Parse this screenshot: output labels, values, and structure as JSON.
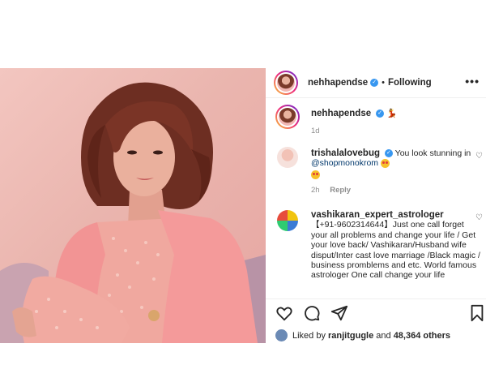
{
  "post": {
    "username": "nehhapendse",
    "separator": "•",
    "follow_status": "Following",
    "more": "•••"
  },
  "caption": {
    "username": "nehhapendse",
    "emoji": "💃",
    "time": "1d"
  },
  "comments": [
    {
      "username": "trishalalovebug",
      "text_before": "You look stunning in ",
      "mention": "@shopmonokrom",
      "time": "2h",
      "reply": "Reply"
    },
    {
      "username": "vashikaran_expert_astrologer",
      "text": "【+91-9602314644】Just one call forget your all problems and change your life / Get your love back/ Vashikaran/Husband wife disput/Inter cast love marriage /Black magic / business promblems and etc. World famous astrologer One call change your life"
    }
  ],
  "likes": {
    "prefix": "Liked by ",
    "user": "ranjitgugle",
    "middle": " and ",
    "count": "48,364 others"
  },
  "icons": [
    "heart-icon",
    "comment-icon",
    "share-icon",
    "bookmark-icon",
    "verified-icon",
    "more-options-icon"
  ],
  "colors": {
    "verified": "#3897f0",
    "muted": "#8e8e8e",
    "photo_bg": "#efb9b2",
    "blazer": "#f49a9a"
  }
}
